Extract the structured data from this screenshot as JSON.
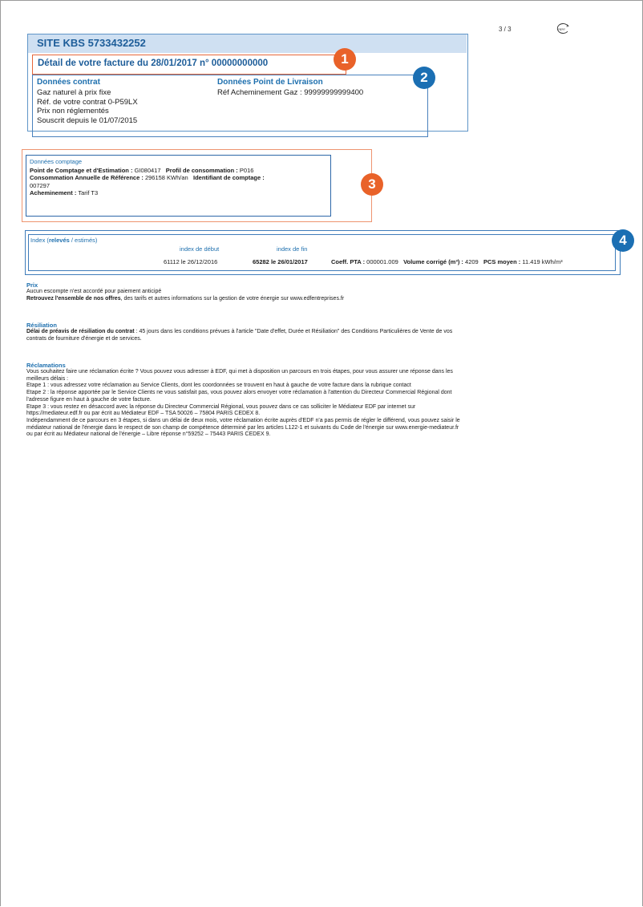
{
  "page": {
    "page_number": "3 / 3",
    "paper_logo_text": "papier"
  },
  "site": {
    "title": "SITE KBS 5733432252",
    "facture_title": "Détail de votre facture du 28/01/2017 n° 00000000000"
  },
  "contrat": {
    "heading": "Données contrat",
    "lines": [
      "Gaz naturel à prix fixe",
      "Réf. de votre contrat 0-P59LX",
      "Prix non réglementés",
      "Souscrit depuis le 01/07/2015"
    ]
  },
  "livraison": {
    "heading": "Données Point de Livraison",
    "ref": "Réf Acheminement Gaz : 99999999999400"
  },
  "badges": [
    "1",
    "2",
    "3",
    "4"
  ],
  "comptage": {
    "heading": "Données comptage",
    "pce_label": "Point de Comptage et d'Estimation :",
    "pce_value": "GI080417",
    "profil_label": "Profil de consommation :",
    "profil_value": "P016",
    "car_label": "Consommation Annuelle de Référence :",
    "car_value": "296158 KWh/an",
    "ident_label": "Identifiant de comptage :",
    "ident_value": "007297",
    "achem_label": "Acheminement :",
    "achem_value": "Tarif T3"
  },
  "index": {
    "heading_prefix": "Index (",
    "heading_bold": "relevés",
    "heading_suffix": " / estimés)",
    "col_debut": "index de début",
    "col_fin": "index de fin",
    "debut_value": "61112 le 26/12/2016",
    "fin_value": "65282 le 26/01/2017",
    "coeff_label": "Coeff. PTA :",
    "coeff_value": "000001.009",
    "volume_label": "Volume corrigé (m³) :",
    "volume_value": "4209",
    "pcs_label": "PCS moyen :",
    "pcs_value": "11.419 kWh/m³"
  },
  "prix": {
    "title": "Prix",
    "line1": "Aucun escompte n'est accordé pour paiement anticipé",
    "line2_bold": "Retrouvez l'ensemble de nos offres",
    "line2_rest": ", des tarifs et autres informations sur la gestion de votre énergie sur www.edfentreprises.fr"
  },
  "resiliation": {
    "title": "Résiliation",
    "bold": "Délai de préavis de résiliation du contrat",
    "rest": " : 45 jours dans les conditions prévues à l'article \"Date d'effet, Durée et Résiliation\" des Conditions Particulières de Vente de vos",
    "line2": "contrats de fourniture d'énergie et de services."
  },
  "reclamations": {
    "title": "Réclamations",
    "lines": [
      "Vous souhaitez faire une réclamation écrite ? Vous pouvez vous adresser à EDF, qui met à disposition un parcours en trois étapes, pour vous assurer une réponse dans les",
      "meilleurs délais :",
      "Etape 1 : vous adressez votre réclamation au Service Clients, dont les coordonnées se trouvent en haut à gauche de votre facture dans la rubrique contact",
      "Etape 2 : la réponse apportée par le Service Clients ne vous satisfait pas, vous pouvez alors envoyer votre réclamation à l'attention du Directeur Commercial Régional dont",
      "l'adresse figure en haut à gauche de votre facture.",
      "Etape 3 : vous restez en désaccord avec la réponse du Directeur Commercial Régional, vous pouvez dans ce cas solliciter le Médiateur EDF par internet sur",
      "https://mediateur.edf.fr ou par écrit au Médiateur EDF – TSA 50026 – 75804 PARIS CEDEX 8.",
      "Indépendamment de ce parcours en 3 étapes, si dans un délai de deux mois, votre réclamation écrite auprès d'EDF n'a pas permis de régler le différend, vous pouvez saisir le",
      "médiateur national de l'énergie dans le respect de son champ de compétence déterminé par les articles L122-1 et suivants du Code de l'énergie sur www.energie-mediateur.fr",
      "ou par écrit au Médiateur national de l'énergie – Libre réponse n°59252 – 75443 PARIS CEDEX 9."
    ]
  }
}
